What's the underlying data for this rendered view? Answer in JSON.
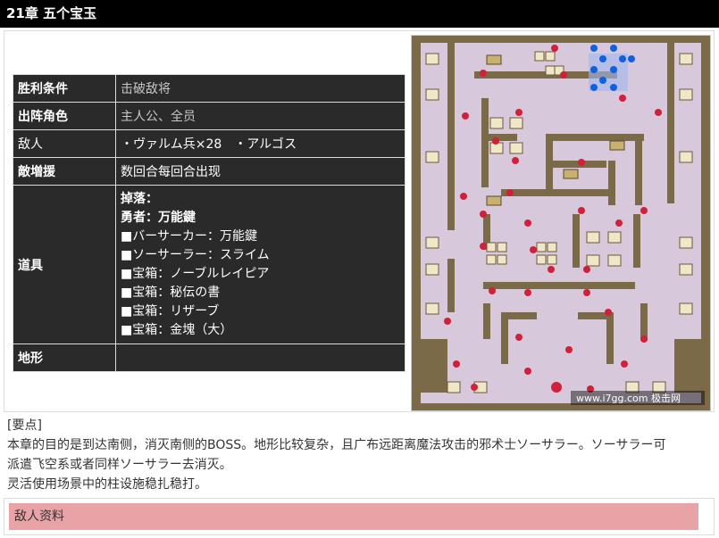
{
  "title": "21章 五个宝玉",
  "table": {
    "rows": [
      {
        "key": "胜利条件",
        "value": "击破敌将"
      },
      {
        "key": "出阵角色",
        "value": "主人公、全员"
      },
      {
        "key": "敌人",
        "value": "・ヴァルム兵×28　・アルゴス"
      },
      {
        "key": "敵増援",
        "value": "数回合每回合出现"
      },
      {
        "key": "道具"
      },
      {
        "key": "地形",
        "value": ""
      }
    ],
    "items": [
      "掉落：",
      "勇者：万能鍵",
      "■バーサーカー：万能鍵",
      "■ソーサーラー：スライム",
      "■宝箱：ノーブルレイピア",
      "■宝箱：秘伝の書",
      "■宝箱：リザーブ",
      "■宝箱：金塊（大）"
    ]
  },
  "map": {
    "watermark": "www.i7gg.com 极击网",
    "colors": {
      "floor": "#d8c8dc",
      "wall": "#7a6a48",
      "enemy": "#d0203a",
      "player": "#1060e0"
    }
  },
  "notes": {
    "heading": "[要点]",
    "line1": "本章的目的是到达南侧，消灭南侧的BOSS。地形比较复杂，且广布远距离魔法攻击的邪术士ソーサラー。ソーサラー可",
    "line2": "派遣飞空系或者同样ソーサラー去消灭。",
    "line3": "灵活使用场景中的柱设施稳扎稳打。"
  },
  "enemy_section": {
    "label": "敌人资料"
  }
}
